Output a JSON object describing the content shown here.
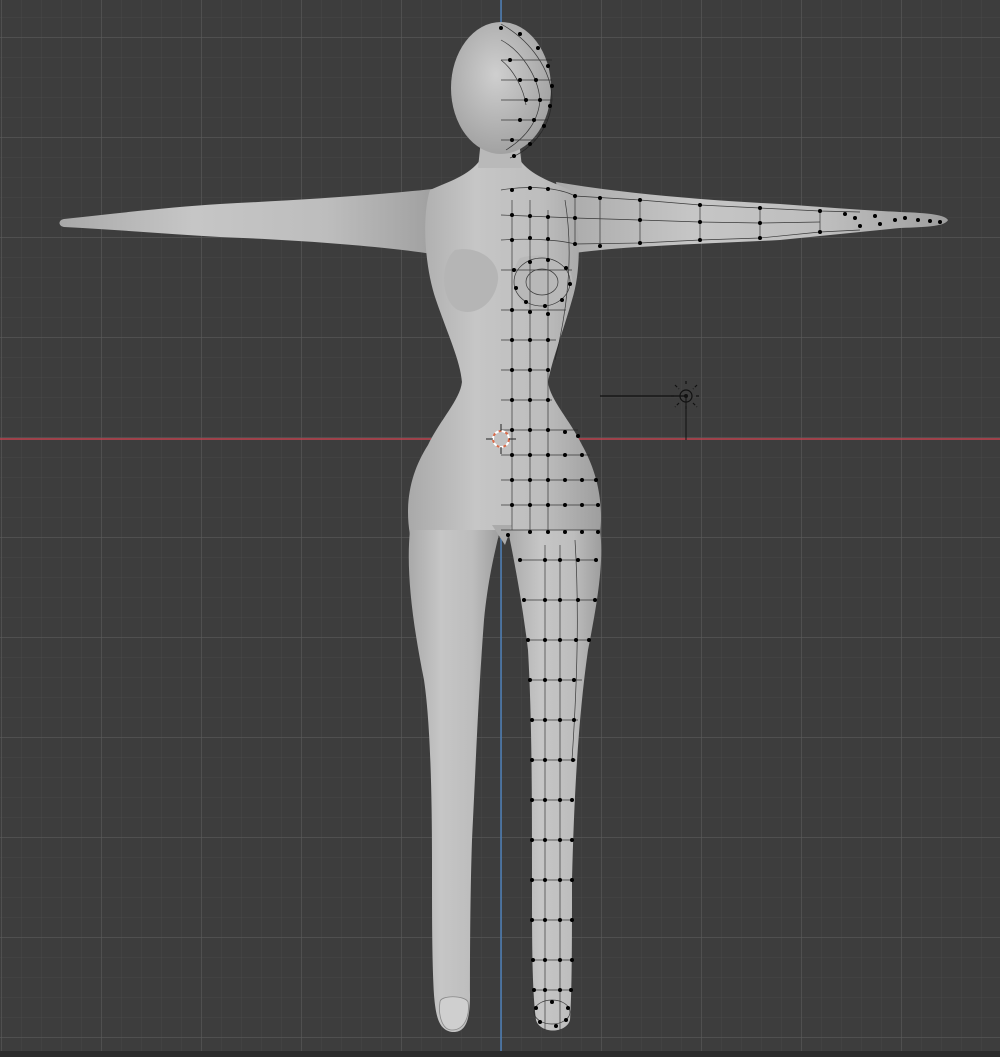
{
  "viewport": {
    "view": "front-orthographic",
    "background_color": "#3d3d3d",
    "grid_visible": true,
    "x_axis_color": "#c0434f",
    "z_axis_color": "#4d7fb8"
  },
  "mesh": {
    "object": "female-base-body",
    "mode": "edit",
    "modifier": "mirror",
    "surface_color": "#bdbdbd",
    "wire_color": "#1a1a1a",
    "vertex_color": "#000000"
  },
  "scene_objects": [
    {
      "name": "light-icon",
      "kind": "light"
    },
    {
      "name": "3d-cursor-icon",
      "kind": "3d-cursor"
    }
  ]
}
